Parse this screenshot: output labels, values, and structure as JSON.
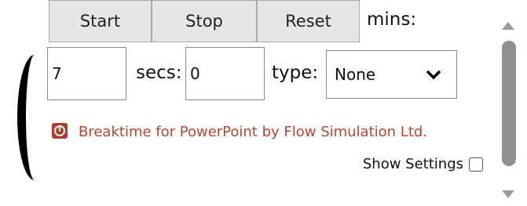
{
  "controls": {
    "start_label": "Start",
    "stop_label": "Stop",
    "reset_label": "Reset"
  },
  "timer": {
    "mins_label": "mins:",
    "mins_value": "7",
    "secs_label": "secs:",
    "secs_value": "0",
    "type_label": "type:",
    "type_value": "None"
  },
  "credit": {
    "icon": "stopwatch-icon",
    "text": "Breaktime for PowerPoint by Flow Simulation Ltd."
  },
  "settings": {
    "show_settings_label": "Show Settings",
    "checked": false
  },
  "colors": {
    "credit_text": "#b5472f",
    "button_bg": "#e6e6e6"
  }
}
